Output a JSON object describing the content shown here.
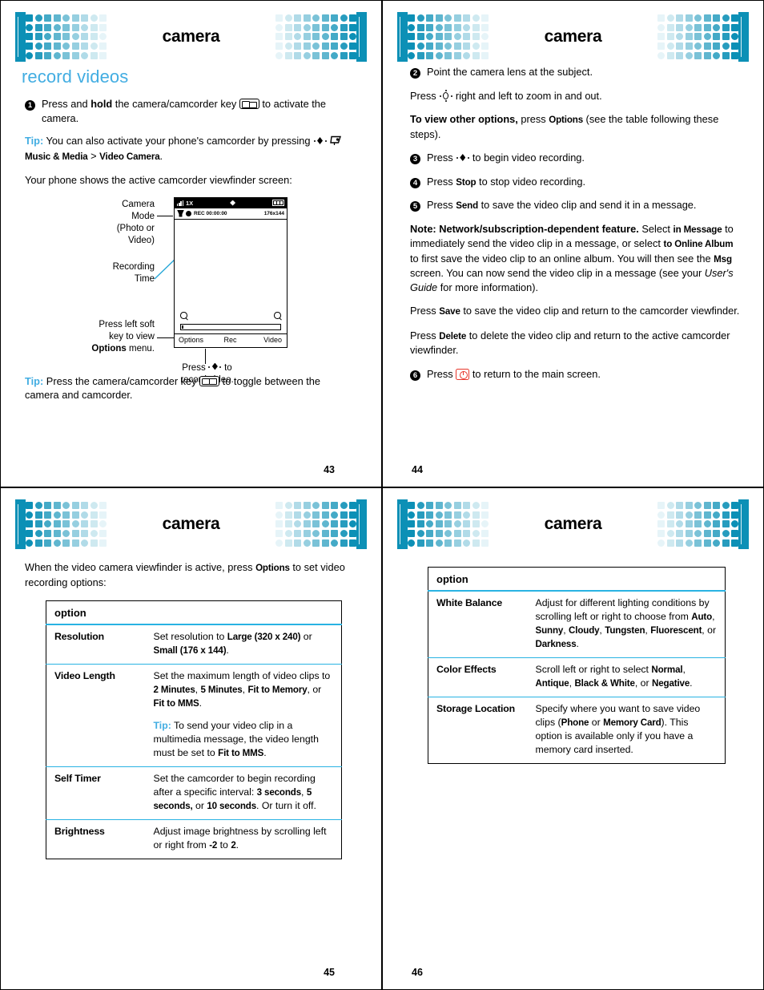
{
  "colors": {
    "brand_teal": "#0c90b6",
    "heading_blue": "#42ade2",
    "rule_blue": "#29b3e3",
    "power_key_red": "#e8372c"
  },
  "pages": [
    {
      "id": "p43",
      "banner_title": "camera",
      "page_number": "43",
      "section_title": "record videos",
      "steps": [
        {
          "num": "1",
          "parts": [
            {
              "t": "text",
              "v": "Press and "
            },
            {
              "t": "b",
              "v": "hold"
            },
            {
              "t": "text",
              "v": " the camera/camcorder key "
            },
            {
              "t": "icon",
              "v": "camera-camcorder-key-icon"
            },
            {
              "t": "text",
              "v": " to activate the camera."
            }
          ]
        }
      ],
      "tip1": {
        "label": "Tip:",
        "parts": [
          {
            "t": "text",
            "v": " You can also activate your phone's camcorder by pressing "
          },
          {
            "t": "icon",
            "v": "nav-key-icon"
          },
          {
            "t": "text",
            "v": " "
          },
          {
            "t": "icon",
            "v": "music-media-icon"
          },
          {
            "t": "ui",
            "v": " Music & Media"
          },
          {
            "t": "text",
            "v": " > "
          },
          {
            "t": "ui",
            "v": "Video Camera"
          },
          {
            "t": "text",
            "v": "."
          }
        ]
      },
      "para_viewfinder": "Your phone shows the active camcorder viewfinder screen:",
      "diagram": {
        "callouts": {
          "camera_mode": [
            "Camera",
            "Mode",
            "(Photo or",
            "Video)"
          ],
          "recording_time": [
            "Recording",
            "Time"
          ],
          "soft_key_line1": "Press left soft",
          "soft_key_line2": "key to view",
          "soft_key_line3_bold": "Options",
          "soft_key_line3_rest": " menu.",
          "press_center_line1_pre": "Press ",
          "press_center_line1_post": " to",
          "press_center_line2": "record video."
        },
        "phone_screen": {
          "status_network": "1X",
          "rec_label": "REC 00:00:00",
          "resolution": "176x144",
          "softkey_left": "Options",
          "softkey_center": "Rec",
          "softkey_right": "Video"
        }
      },
      "tip2": {
        "label": "Tip:",
        "parts": [
          {
            "t": "text",
            "v": " Press the camera/camcorder key "
          },
          {
            "t": "icon",
            "v": "camera-camcorder-key-icon"
          },
          {
            "t": "text",
            "v": " to toggle between the camera and camcorder."
          }
        ]
      }
    },
    {
      "id": "p44",
      "banner_title": "camera",
      "page_number": "44",
      "blocks": [
        {
          "kind": "step",
          "num": "2",
          "parts": [
            {
              "t": "text",
              "v": "Point the camera lens at the subject."
            }
          ]
        },
        {
          "kind": "para",
          "indent": true,
          "parts": [
            {
              "t": "text",
              "v": "Press "
            },
            {
              "t": "icon",
              "v": "nav-key-ring-icon"
            },
            {
              "t": "text",
              "v": " right and left to zoom in and out."
            }
          ]
        },
        {
          "kind": "para",
          "indent": true,
          "parts": [
            {
              "t": "b",
              "v": "To view other options,"
            },
            {
              "t": "text",
              "v": " press "
            },
            {
              "t": "ui",
              "v": "Options"
            },
            {
              "t": "text",
              "v": " (see the table following these steps)."
            }
          ]
        },
        {
          "kind": "step",
          "num": "3",
          "parts": [
            {
              "t": "text",
              "v": "Press "
            },
            {
              "t": "icon",
              "v": "nav-key-icon"
            },
            {
              "t": "text",
              "v": " to begin video recording."
            }
          ]
        },
        {
          "kind": "step",
          "num": "4",
          "parts": [
            {
              "t": "text",
              "v": "Press "
            },
            {
              "t": "ui",
              "v": "Stop"
            },
            {
              "t": "text",
              "v": " to stop video recording."
            }
          ]
        },
        {
          "kind": "step",
          "num": "5",
          "parts": [
            {
              "t": "text",
              "v": "Press "
            },
            {
              "t": "ui",
              "v": "Send"
            },
            {
              "t": "text",
              "v": " to save the video clip and send it in a message."
            }
          ]
        },
        {
          "kind": "para",
          "indent": true,
          "parts": [
            {
              "t": "b",
              "v": "Note: Network/subscription-dependent feature."
            },
            {
              "t": "text",
              "v": " Select "
            },
            {
              "t": "ui",
              "v": "in Message"
            },
            {
              "t": "text",
              "v": " to immediately send the video clip in a message, or select "
            },
            {
              "t": "ui",
              "v": "to Online Album"
            },
            {
              "t": "text",
              "v": " to first save the video clip to an online album. You will then see the "
            },
            {
              "t": "ui",
              "v": "Msg"
            },
            {
              "t": "text",
              "v": " screen. You can now send the video clip in a message (see your "
            },
            {
              "t": "i",
              "v": "User's Guide"
            },
            {
              "t": "text",
              "v": " for more information)."
            }
          ]
        },
        {
          "kind": "para",
          "indent": true,
          "parts": [
            {
              "t": "text",
              "v": "Press "
            },
            {
              "t": "ui",
              "v": "Save"
            },
            {
              "t": "text",
              "v": " to save the video clip and return to the camcorder viewfinder."
            }
          ]
        },
        {
          "kind": "para",
          "indent": true,
          "parts": [
            {
              "t": "text",
              "v": "Press "
            },
            {
              "t": "ui",
              "v": "Delete"
            },
            {
              "t": "text",
              "v": " to delete the video clip and return to the active camcorder viewfinder."
            }
          ]
        },
        {
          "kind": "step",
          "num": "6",
          "parts": [
            {
              "t": "text",
              "v": "Press "
            },
            {
              "t": "icon",
              "v": "power-end-key-icon"
            },
            {
              "t": "text",
              "v": " to return to the main screen."
            }
          ]
        }
      ]
    },
    {
      "id": "p45",
      "banner_title": "camera",
      "page_number": "45",
      "intro_parts": [
        {
          "t": "text",
          "v": "When the video camera viewfinder is active, press "
        },
        {
          "t": "ui",
          "v": "Options"
        },
        {
          "t": "text",
          "v": " to set video recording options:"
        }
      ],
      "table": {
        "header": "option",
        "rows": [
          {
            "name": "Resolution",
            "desc": [
              [
                {
                  "t": "text",
                  "v": "Set resolution to "
                },
                {
                  "t": "ui",
                  "v": "Large (320 x 240)"
                },
                {
                  "t": "text",
                  "v": " or "
                },
                {
                  "t": "ui",
                  "v": "Small (176 x 144)"
                },
                {
                  "t": "text",
                  "v": "."
                }
              ]
            ]
          },
          {
            "name": "Video Length",
            "desc": [
              [
                {
                  "t": "text",
                  "v": "Set the maximum length of video clips to "
                },
                {
                  "t": "ui",
                  "v": "2 Minutes"
                },
                {
                  "t": "text",
                  "v": ", "
                },
                {
                  "t": "ui",
                  "v": "5 Minutes"
                },
                {
                  "t": "text",
                  "v": ", "
                },
                {
                  "t": "ui",
                  "v": "Fit to Memory"
                },
                {
                  "t": "text",
                  "v": ", or "
                },
                {
                  "t": "ui",
                  "v": "Fit to MMS"
                },
                {
                  "t": "text",
                  "v": "."
                }
              ],
              [
                {
                  "t": "tip",
                  "v": "Tip:"
                },
                {
                  "t": "text",
                  "v": " To send your video clip in a multimedia message, the video length must be set to "
                },
                {
                  "t": "ui",
                  "v": "Fit to MMS"
                },
                {
                  "t": "text",
                  "v": "."
                }
              ]
            ]
          },
          {
            "name": "Self Timer",
            "desc": [
              [
                {
                  "t": "text",
                  "v": "Set the camcorder to begin recording after a specific interval: "
                },
                {
                  "t": "ui",
                  "v": "3 seconds"
                },
                {
                  "t": "text",
                  "v": ", "
                },
                {
                  "t": "ui",
                  "v": "5 seconds,"
                },
                {
                  "t": "text",
                  "v": " or "
                },
                {
                  "t": "ui",
                  "v": "10 seconds"
                },
                {
                  "t": "text",
                  "v": ". Or turn it off."
                }
              ]
            ]
          },
          {
            "name": "Brightness",
            "desc": [
              [
                {
                  "t": "text",
                  "v": "Adjust image brightness by scrolling left or right from "
                },
                {
                  "t": "ui",
                  "v": "-2"
                },
                {
                  "t": "text",
                  "v": " to "
                },
                {
                  "t": "ui",
                  "v": "2"
                },
                {
                  "t": "text",
                  "v": "."
                }
              ]
            ]
          }
        ]
      }
    },
    {
      "id": "p46",
      "banner_title": "camera",
      "page_number": "46",
      "table": {
        "header": "option",
        "rows": [
          {
            "name": "White Balance",
            "desc": [
              [
                {
                  "t": "text",
                  "v": "Adjust for different lighting conditions by scrolling left or right to choose from "
                },
                {
                  "t": "ui",
                  "v": "Auto"
                },
                {
                  "t": "text",
                  "v": ", "
                },
                {
                  "t": "ui",
                  "v": "Sunny"
                },
                {
                  "t": "text",
                  "v": ", "
                },
                {
                  "t": "ui",
                  "v": "Cloudy"
                },
                {
                  "t": "text",
                  "v": ", "
                },
                {
                  "t": "ui",
                  "v": "Tungsten"
                },
                {
                  "t": "text",
                  "v": ", "
                },
                {
                  "t": "ui",
                  "v": "Fluorescent"
                },
                {
                  "t": "text",
                  "v": ", or "
                },
                {
                  "t": "ui",
                  "v": "Darkness"
                },
                {
                  "t": "text",
                  "v": "."
                }
              ]
            ]
          },
          {
            "name": "Color Effects",
            "desc": [
              [
                {
                  "t": "text",
                  "v": "Scroll left or right to select "
                },
                {
                  "t": "ui",
                  "v": "Normal"
                },
                {
                  "t": "text",
                  "v": ", "
                },
                {
                  "t": "ui",
                  "v": "Antique"
                },
                {
                  "t": "text",
                  "v": ", "
                },
                {
                  "t": "ui",
                  "v": "Black & White"
                },
                {
                  "t": "text",
                  "v": ", or "
                },
                {
                  "t": "ui",
                  "v": "Negative"
                },
                {
                  "t": "text",
                  "v": "."
                }
              ]
            ]
          },
          {
            "name": "Storage Location",
            "desc": [
              [
                {
                  "t": "text",
                  "v": "Specify where you want to save video clips ("
                },
                {
                  "t": "ui",
                  "v": "Phone"
                },
                {
                  "t": "text",
                  "v": " or "
                },
                {
                  "t": "ui",
                  "v": "Memory Card"
                },
                {
                  "t": "text",
                  "v": "). This option is available only if you have a memory card inserted."
                }
              ]
            ]
          }
        ]
      }
    }
  ]
}
